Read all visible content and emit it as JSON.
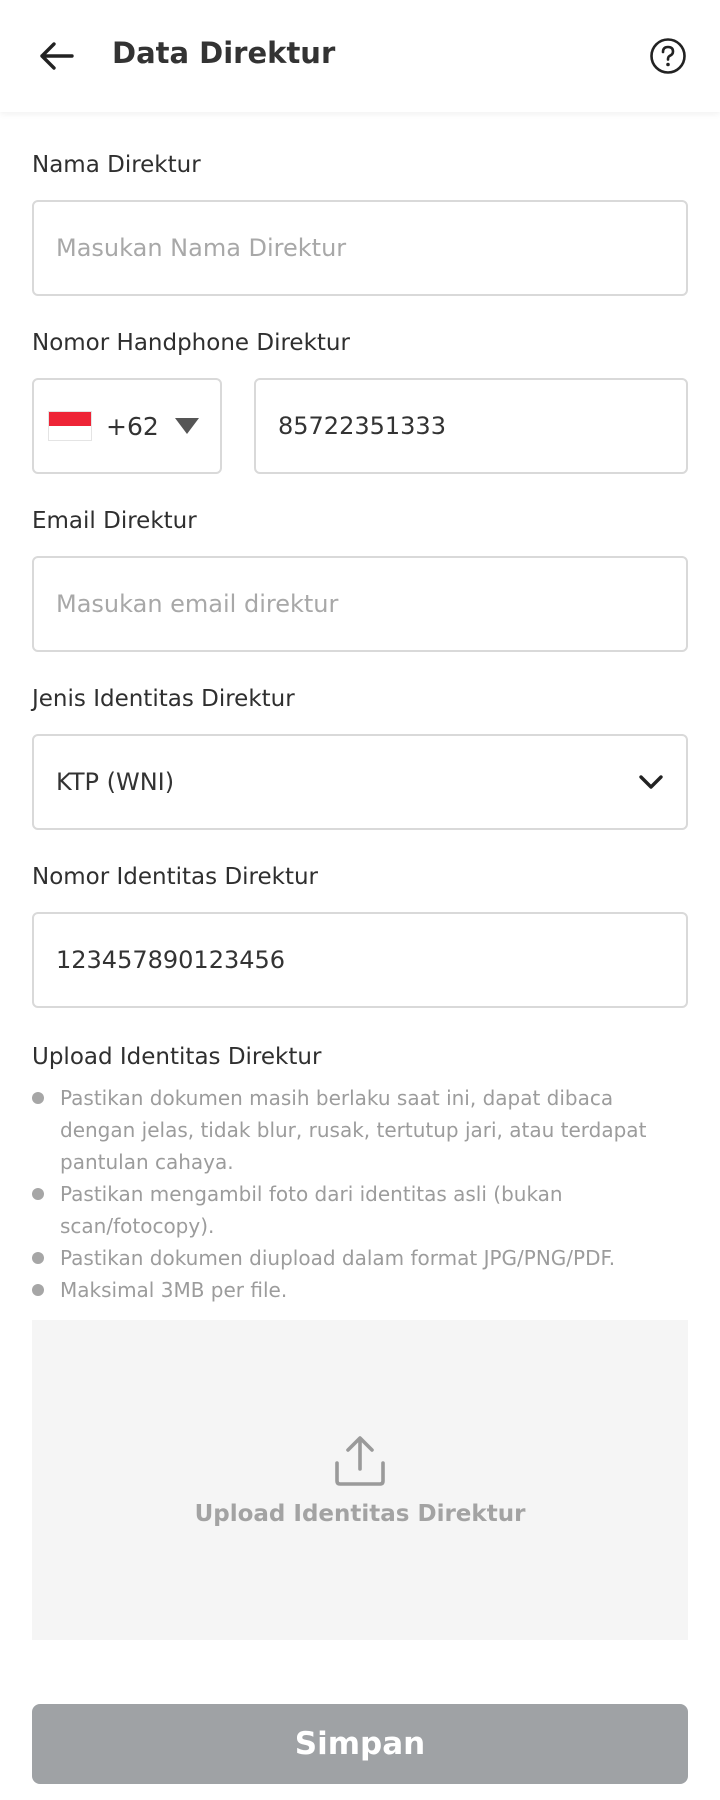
{
  "header": {
    "title": "Data Direktur",
    "back_icon": "arrow-left-icon",
    "help_icon": "question-circle-icon"
  },
  "form": {
    "name": {
      "label": "Nama Direktur",
      "placeholder": "Masukan Nama Direktur",
      "value": ""
    },
    "phone": {
      "label": "Nomor Handphone Direktur",
      "country_code": "+62",
      "flag_icon": "indonesia-flag-icon",
      "value": "85722351333"
    },
    "email": {
      "label": "Email Direktur",
      "placeholder": "Masukan email direktur",
      "value": ""
    },
    "id_type": {
      "label": "Jenis Identitas Direktur",
      "selected": "KTP (WNI)"
    },
    "id_number": {
      "label": "Nomor Identitas Direktur",
      "value": "123457890123456"
    },
    "upload": {
      "title": "Upload Identitas Direktur",
      "guidelines": [
        "Pastikan dokumen masih berlaku saat ini, dapat dibaca dengan jelas, tidak blur, rusak, tertutup jari, atau terdapat pantulan cahaya.",
        "Pastikan mengambil foto dari identitas asli (bukan scan/fotocopy).",
        "Pastikan dokumen diupload dalam format JPG/PNG/PDF.",
        "Maksimal 3MB per file."
      ],
      "area_label": "Upload Identitas Direktur",
      "area_icon": "upload-icon"
    }
  },
  "actions": {
    "save_label": "Simpan"
  },
  "colors": {
    "flag_red": "#ee2436",
    "button_disabled": "#9fa2a5",
    "upload_bg": "#f5f5f5"
  }
}
